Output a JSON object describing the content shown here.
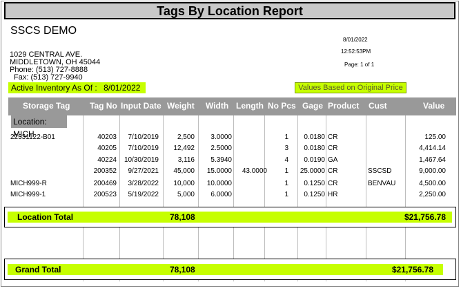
{
  "report": {
    "title": "Tags By Location Report",
    "company": "SSCS DEMO",
    "date": "8/01/2022",
    "time": "12:52:53PM",
    "page": "Page: 1 of 1",
    "address": [
      "1029 CENTRAL AVE.",
      "MIDDLETOWN, OH 45044",
      "Phone: (513) 727-8888",
      "Fax: (513) 727-9940"
    ],
    "inventory_label": "Active Inventory As Of :",
    "inventory_date": "8/01/2022",
    "values_note": "Values Based on Original Price"
  },
  "table": {
    "headers": [
      "Storage Tag",
      "Tag No",
      "Input Date",
      "Weight",
      "Width",
      "Length",
      "No Pcs",
      "Gage",
      "Product",
      "Cust",
      "Value"
    ],
    "location_label": "Location:",
    "location": "MICH",
    "rows": [
      {
        "storage_tag": "22331122-B01",
        "tag_no": "40203",
        "input_date": "7/10/2019",
        "weight": "2,500",
        "width": "3.0000",
        "length": "",
        "no_pcs": "1",
        "gage": "0.0180",
        "product": "CR",
        "cust": "",
        "value": "125.00"
      },
      {
        "storage_tag": "",
        "tag_no": "40205",
        "input_date": "7/10/2019",
        "weight": "12,492",
        "width": "2.5000",
        "length": "",
        "no_pcs": "3",
        "gage": "0.0180",
        "product": "CR",
        "cust": "",
        "value": "4,414.14"
      },
      {
        "storage_tag": "",
        "tag_no": "40224",
        "input_date": "10/30/2019",
        "weight": "3,116",
        "width": "5.3940",
        "length": "",
        "no_pcs": "4",
        "gage": "0.0190",
        "product": "GA",
        "cust": "",
        "value": "1,467.64"
      },
      {
        "storage_tag": "",
        "tag_no": "200352",
        "input_date": "9/27/2021",
        "weight": "45,000",
        "width": "15.0000",
        "length": "43.0000",
        "no_pcs": "1",
        "gage": "25.0000",
        "product": "CR",
        "cust": "SSCSD",
        "value": "9,000.00"
      },
      {
        "storage_tag": "MICH999-R",
        "tag_no": "200469",
        "input_date": "3/28/2022",
        "weight": "10,000",
        "width": "10.0000",
        "length": "",
        "no_pcs": "1",
        "gage": "0.1250",
        "product": "CR",
        "cust": "BENVAU",
        "value": "4,500.00"
      },
      {
        "storage_tag": "MICH999-1",
        "tag_no": "200523",
        "input_date": "5/19/2022",
        "weight": "5,000",
        "width": "6.0000",
        "length": "",
        "no_pcs": "1",
        "gage": "0.1250",
        "product": "HR",
        "cust": "",
        "value": "2,250.00"
      }
    ],
    "location_total": {
      "label": "Location Total",
      "weight": "78,108",
      "value": "$21,756.78"
    },
    "grand_total": {
      "label": "Grand Total",
      "weight": "78,108",
      "value": "$21,756.78"
    }
  }
}
